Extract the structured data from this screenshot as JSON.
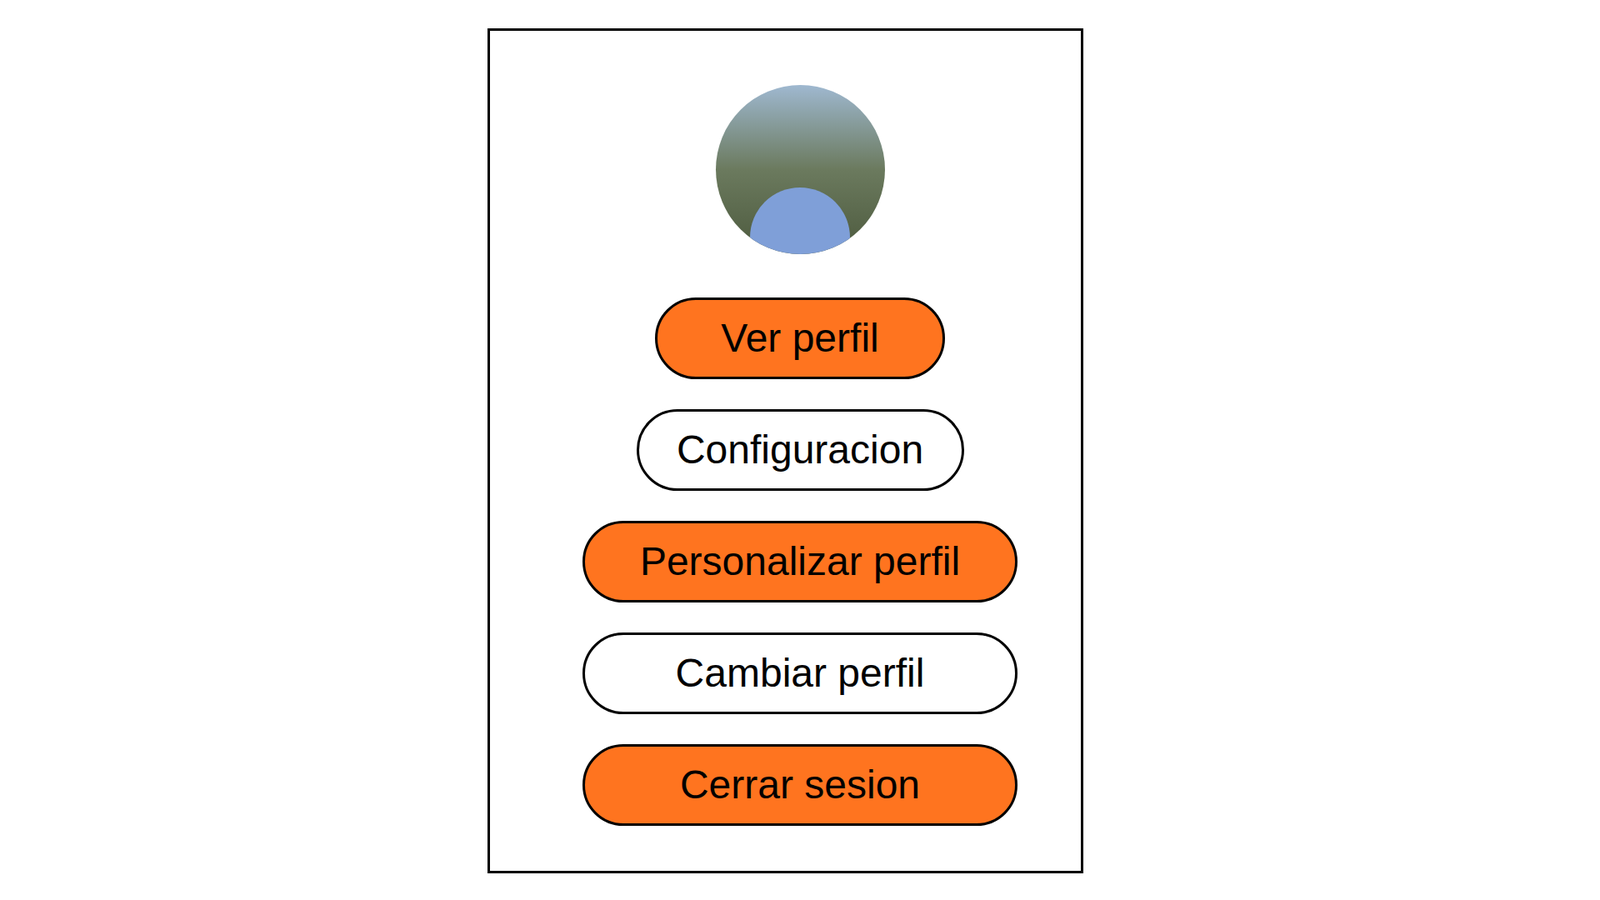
{
  "menu": {
    "items": [
      {
        "label": "Ver perfil",
        "highlighted": true
      },
      {
        "label": "Configuracion",
        "highlighted": false
      },
      {
        "label": "Personalizar perfil",
        "highlighted": true
      },
      {
        "label": "Cambiar perfil",
        "highlighted": false
      },
      {
        "label": "Cerrar sesion",
        "highlighted": true
      }
    ]
  }
}
